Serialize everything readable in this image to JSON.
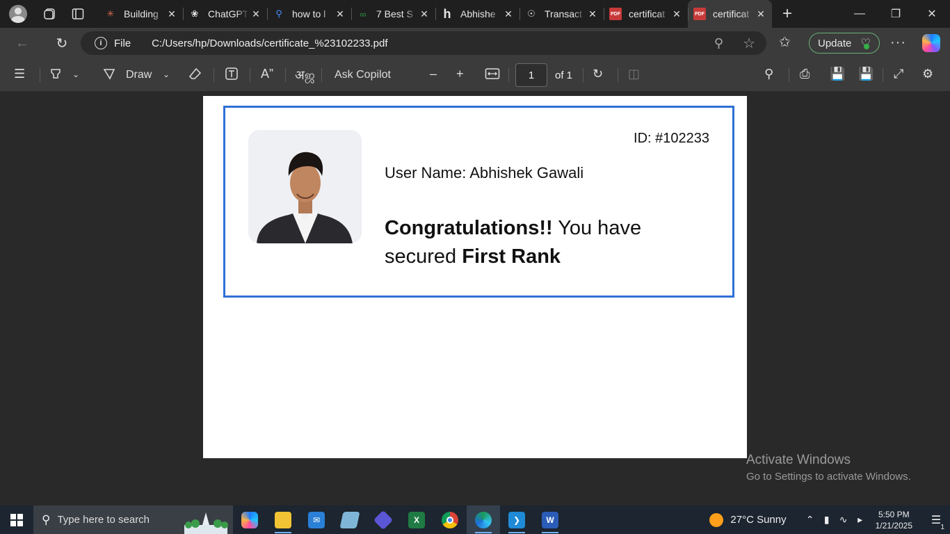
{
  "browser": {
    "tabs": [
      {
        "title": "Building",
        "favicon": "spark-icon",
        "color": "#d66b4a",
        "active": false
      },
      {
        "title": "ChatGPT",
        "favicon": "openai-icon",
        "color": "#e6e6e6",
        "active": false
      },
      {
        "title": "how to l",
        "favicon": "search-icon",
        "color": "#4a8cff",
        "active": false
      },
      {
        "title": "7 Best S",
        "favicon": "gfg-icon",
        "color": "#2f8d46",
        "active": false
      },
      {
        "title": "Abhishe",
        "favicon": "h-icon",
        "color": "#e6e6e6",
        "active": false
      },
      {
        "title": "Transact",
        "favicon": "globe-icon",
        "color": "#e6e6e6",
        "active": false
      },
      {
        "title": "certificat",
        "favicon": "pdf-icon",
        "color": "#c83a3a",
        "active": false
      },
      {
        "title": "certificat",
        "favicon": "pdf-icon",
        "color": "#c83a3a",
        "active": true
      }
    ],
    "pdf_favicon_text": "PDF",
    "address": {
      "scheme_label": "File",
      "url": "C:/Users/hp/Downloads/certificate_%23102233.pdf"
    },
    "update_label": "Update"
  },
  "pdf_toolbar": {
    "draw_label": "Draw",
    "ask_copilot_label": "Ask Copilot",
    "page_number": "1",
    "page_of": "of 1"
  },
  "certificate": {
    "id_text": "ID: #102233",
    "user_name_text": "User Name: Abhishek Gawali",
    "congrats_bold": "Congratulations!!",
    "congrats_rest": " You have secured ",
    "rank_bold": "First Rank",
    "frame_color": "#2f6fd6"
  },
  "watermark": {
    "line1": "Activate Windows",
    "line2": "Go to Settings to activate Windows."
  },
  "taskbar": {
    "search_placeholder": "Type here to search",
    "weather": "27°C  Sunny",
    "time": "5:50 PM",
    "date": "1/21/2025",
    "notification_count": "1"
  }
}
